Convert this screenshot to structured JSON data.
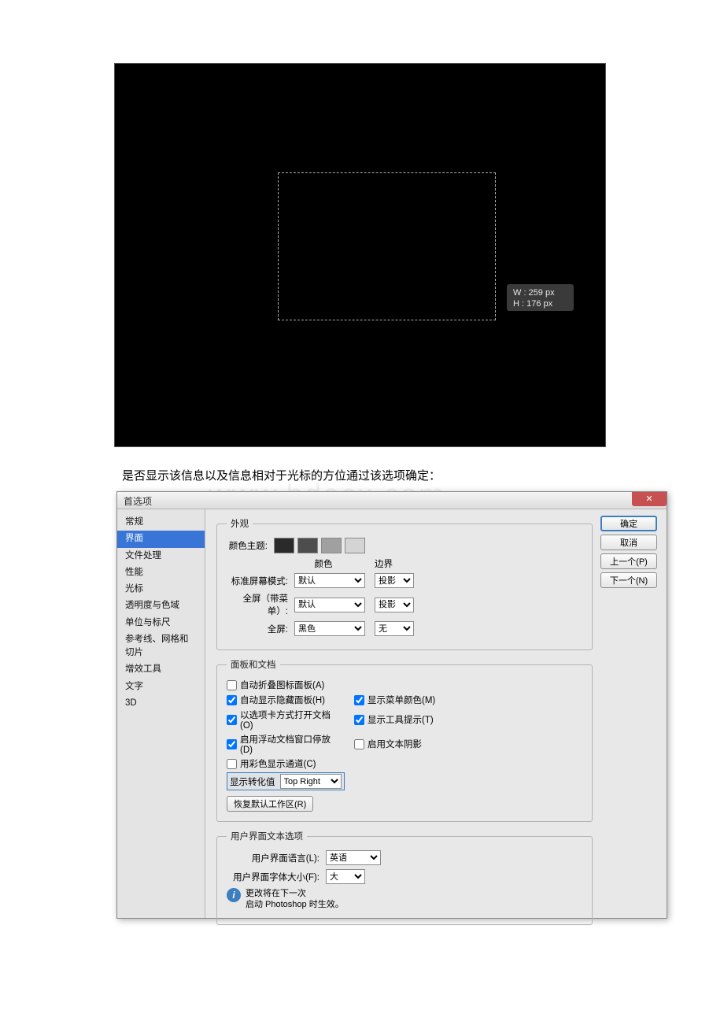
{
  "canvas": {
    "w_label": "W :  259 px",
    "h_label": "H :  176 px"
  },
  "explain": "是否显示该信息以及信息相对于光标的方位通过该选项确定：",
  "watermark": "www.bdocx.com",
  "dialog": {
    "title": "首选项",
    "close": "✕",
    "sidebar": [
      "常规",
      "界面",
      "文件处理",
      "性能",
      "光标",
      "透明度与色域",
      "单位与标尺",
      "参考线、网格和切片",
      "增效工具",
      "文字",
      "3D"
    ],
    "sidebar_active_index": 1,
    "buttons": {
      "ok": "确定",
      "cancel": "取消",
      "prev": "上一个(P)",
      "next": "下一个(N)"
    },
    "appearance": {
      "legend": "外观",
      "theme_label": "颜色主题:",
      "col_color": "颜色",
      "col_border": "边界",
      "rows": [
        {
          "label": "标准屏幕模式:",
          "color": "默认",
          "border": "投影"
        },
        {
          "label": "全屏（带菜单）:",
          "color": "默认",
          "border": "投影"
        },
        {
          "label": "全屏:",
          "color": "黑色",
          "border": "无"
        }
      ]
    },
    "panels": {
      "legend": "面板和文档",
      "c1": {
        "checked": false,
        "label": "自动折叠图标面板(A)"
      },
      "c2": {
        "checked": true,
        "label": "自动显示隐藏面板(H)"
      },
      "c3": {
        "checked": true,
        "label": "以选项卡方式打开文档(O)"
      },
      "c4": {
        "checked": true,
        "label": "启用浮动文档窗口停放(D)"
      },
      "c5": {
        "checked": false,
        "label": "用彩色显示通道(C)"
      },
      "c6": {
        "checked": true,
        "label": "显示菜单颜色(M)"
      },
      "c7": {
        "checked": true,
        "label": "显示工具提示(T)"
      },
      "c8": {
        "checked": false,
        "label": "启用文本阴影"
      },
      "transform_label": "显示转化值",
      "transform_value": "Top Right",
      "reset_btn": "恢复默认工作区(R)"
    },
    "textopts": {
      "legend": "用户界面文本选项",
      "lang_label": "用户界面语言(L):",
      "lang_value": "英语",
      "font_label": "用户界面字体大小(F):",
      "font_value": "大",
      "info": "更改将在下一次\n启动 Photoshop 时生效。"
    }
  }
}
